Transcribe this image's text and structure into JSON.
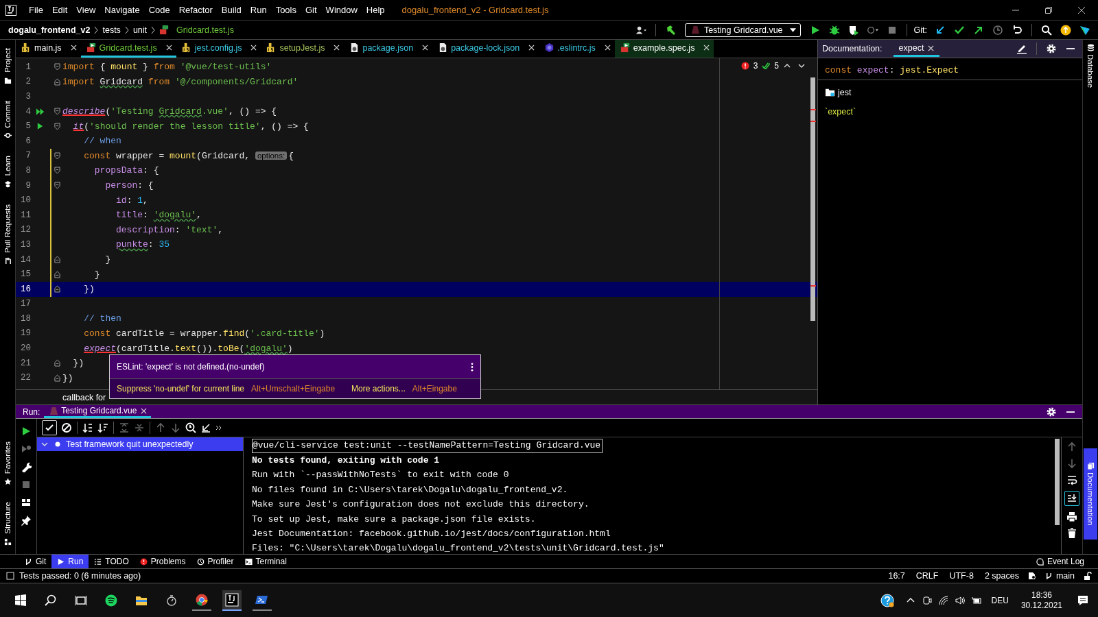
{
  "window": {
    "title": "dogalu_frontend_v2 - Gridcard.test.js"
  },
  "menu": [
    "File",
    "Edit",
    "View",
    "Navigate",
    "Code",
    "Refactor",
    "Build",
    "Run",
    "Tools",
    "Git",
    "Window",
    "Help"
  ],
  "breadcrumbs": [
    {
      "label": "dogalu_frontend_v2",
      "kind": "project"
    },
    {
      "label": "tests",
      "kind": "folder"
    },
    {
      "label": "unit",
      "kind": "folder"
    },
    {
      "label": "Gridcard.test.js",
      "kind": "file"
    }
  ],
  "toolbar": {
    "run_configuration": "Testing Gridcard.vue",
    "git_label": "Git:"
  },
  "left_strip": {
    "top": [
      {
        "label": "Project",
        "kind": "folder"
      },
      {
        "label": "Commit",
        "kind": "commit"
      },
      {
        "label": "Learn",
        "kind": "learn"
      },
      {
        "label": "Pull Requests",
        "kind": "pr"
      }
    ],
    "bottom": [
      {
        "label": "Favorites",
        "kind": "star"
      },
      {
        "label": "Structure",
        "kind": "structure"
      }
    ]
  },
  "right_strip": [
    {
      "label": "Database",
      "kind": "database",
      "selected": false
    },
    {
      "label": "Documentation",
      "kind": "doc",
      "selected": true
    }
  ],
  "tabs": [
    {
      "label": "main.js",
      "kind": "js",
      "color": "#ffffff",
      "selected": false
    },
    {
      "label": "Gridcard.test.js",
      "kind": "test",
      "color": "#6fc83b",
      "selected": true
    },
    {
      "label": "jest.config.js",
      "kind": "js",
      "color": "#3ccbe6",
      "selected": false
    },
    {
      "label": "setupJest.js",
      "kind": "js",
      "color": "#a5c25c",
      "selected": false
    },
    {
      "label": "package.json",
      "kind": "json",
      "color": "#3ccbe6",
      "selected": false
    },
    {
      "label": "package-lock.json",
      "kind": "json",
      "color": "#3ccbe6",
      "selected": false
    },
    {
      "label": ".eslintrc.js",
      "kind": "eslint",
      "color": "#3ccbe6",
      "selected": false
    },
    {
      "label": "example.spec.js",
      "kind": "test",
      "color": "#ffffff",
      "selected": false
    }
  ],
  "inspections": {
    "errors": "3",
    "warnings": "5"
  },
  "code": [
    {
      "number": "1",
      "current": false,
      "fold_start": true,
      "tokens": [
        {
          "t": "import",
          "kind": "kw"
        },
        {
          "t": " { ",
          "kind": "plain"
        },
        {
          "t": "mount",
          "kind": "fn"
        },
        {
          "t": " } ",
          "kind": "plain"
        },
        {
          "t": "from",
          "kind": "kw"
        },
        {
          "t": " '@vue/test-utils'",
          "kind": "str"
        }
      ]
    },
    {
      "number": "2",
      "current": false,
      "fold_end": true,
      "tokens": [
        {
          "t": "import ",
          "kind": "kw"
        },
        {
          "t": "Gridcard",
          "kind": "plain",
          "typo": true
        },
        {
          "t": " from",
          "kind": "kw"
        },
        {
          "t": " '@/components/Gridcard'",
          "kind": "str"
        }
      ]
    },
    {
      "number": "3",
      "current": false
    },
    {
      "number": "4",
      "current": false,
      "run_all": true,
      "fold_start": true,
      "tokens": [
        {
          "t": "describe",
          "kind": "err"
        },
        {
          "t": "(",
          "kind": "plain"
        },
        {
          "t": "'Testing ",
          "kind": "str"
        },
        {
          "t": "Gridcard",
          "kind": "str",
          "typo": true
        },
        {
          "t": ".vue'",
          "kind": "str"
        },
        {
          "t": ", () => {",
          "kind": "plain"
        }
      ]
    },
    {
      "number": "5",
      "current": false,
      "run_one": true,
      "fold_start": true,
      "tokens": [
        {
          "t": "  it",
          "kind": "err"
        },
        {
          "t": "(",
          "kind": "plain"
        },
        {
          "t": "'should render the lesson title'",
          "kind": "str"
        },
        {
          "t": ", () => {",
          "kind": "plain"
        }
      ]
    },
    {
      "number": "6",
      "current": false,
      "tokens": [
        {
          "t": "    // when",
          "kind": "cmt"
        }
      ]
    },
    {
      "number": "7",
      "current": false,
      "changed": true,
      "fold_start": true,
      "tokens": [
        {
          "t": "    const",
          "kind": "kw"
        },
        {
          "t": " wrapper = ",
          "kind": "plain"
        },
        {
          "t": "mount",
          "kind": "fn"
        },
        {
          "t": "(Gridcard, ",
          "kind": "plain"
        },
        {
          "t": "options:",
          "kind": "hint"
        },
        {
          "t": "{",
          "kind": "plain"
        }
      ]
    },
    {
      "number": "8",
      "current": false,
      "changed": true,
      "fold_start": true,
      "tokens": [
        {
          "t": "      propsData",
          "kind": "prop"
        },
        {
          "t": ": {",
          "kind": "plain"
        }
      ]
    },
    {
      "number": "9",
      "current": false,
      "changed": true,
      "fold_start": true,
      "tokens": [
        {
          "t": "        person",
          "kind": "prop"
        },
        {
          "t": ": {",
          "kind": "plain"
        }
      ]
    },
    {
      "number": "10",
      "current": false,
      "changed": true,
      "tokens": [
        {
          "t": "          id",
          "kind": "prop"
        },
        {
          "t": ": ",
          "kind": "plain"
        },
        {
          "t": "1",
          "kind": "num"
        },
        {
          "t": ",",
          "kind": "plain"
        }
      ]
    },
    {
      "number": "11",
      "current": false,
      "changed": true,
      "tokens": [
        {
          "t": "          title",
          "kind": "prop"
        },
        {
          "t": ": ",
          "kind": "plain"
        },
        {
          "t": "'dogalu'",
          "kind": "str",
          "typo": true
        },
        {
          "t": ",",
          "kind": "plain"
        }
      ]
    },
    {
      "number": "12",
      "current": false,
      "changed": true,
      "tokens": [
        {
          "t": "          description",
          "kind": "prop"
        },
        {
          "t": ": ",
          "kind": "plain"
        },
        {
          "t": "'text'",
          "kind": "str"
        },
        {
          "t": ",",
          "kind": "plain"
        }
      ]
    },
    {
      "number": "13",
      "current": false,
      "changed": true,
      "tokens": [
        {
          "t": "          punkte",
          "kind": "prop",
          "typo": true
        },
        {
          "t": ": ",
          "kind": "plain"
        },
        {
          "t": "35",
          "kind": "num"
        }
      ]
    },
    {
      "number": "14",
      "current": false,
      "changed": true,
      "fold_end": true,
      "tokens": [
        {
          "t": "        }",
          "kind": "plain"
        }
      ]
    },
    {
      "number": "15",
      "current": false,
      "changed": true,
      "fold_end": true,
      "tokens": [
        {
          "t": "      }",
          "kind": "plain"
        }
      ]
    },
    {
      "number": "16",
      "current": true,
      "changed": true,
      "fold_end": true,
      "tokens": [
        {
          "t": "    })",
          "kind": "plain"
        }
      ]
    },
    {
      "number": "17",
      "current": false
    },
    {
      "number": "18",
      "current": false,
      "tokens": [
        {
          "t": "    // then",
          "kind": "cmt"
        }
      ]
    },
    {
      "number": "19",
      "current": false,
      "tokens": [
        {
          "t": "    const",
          "kind": "kw"
        },
        {
          "t": " cardTitle = wrapper.",
          "kind": "plain"
        },
        {
          "t": "find",
          "kind": "fn"
        },
        {
          "t": "(",
          "kind": "plain"
        },
        {
          "t": "'.card-title'",
          "kind": "str"
        },
        {
          "t": ")",
          "kind": "plain"
        }
      ]
    },
    {
      "number": "20",
      "current": false,
      "tokens": [
        {
          "t": "    expect",
          "kind": "err"
        },
        {
          "t": "(cardTitle.",
          "kind": "plain"
        },
        {
          "t": "text",
          "kind": "fn"
        },
        {
          "t": "()).",
          "kind": "plain"
        },
        {
          "t": "toBe",
          "kind": "fn"
        },
        {
          "t": "(",
          "kind": "plain"
        },
        {
          "t": "'dogalu'",
          "kind": "str",
          "typo": true
        },
        {
          "t": ")",
          "kind": "plain"
        }
      ]
    },
    {
      "number": "21",
      "current": false,
      "fold_end": true,
      "tokens": [
        {
          "t": "  })",
          "kind": "plain"
        }
      ]
    },
    {
      "number": "22",
      "current": false,
      "fold_end": true,
      "tokens": [
        {
          "t": "})",
          "kind": "plain"
        }
      ]
    }
  ],
  "editor_breadcrumb": "callback for",
  "popup": {
    "message": "ESLint: 'expect' is not defined.(no-undef)",
    "actions": [
      {
        "label": "Suppress 'no-undef' for current line",
        "shortcut": "Alt+Umschalt+Eingabe"
      },
      {
        "label": "More actions...",
        "shortcut": "Alt+Eingabe"
      }
    ]
  },
  "documentation": {
    "header": "Documentation:",
    "tab": "expect",
    "signature": [
      {
        "t": "const",
        "kind": "kw"
      },
      {
        "t": " expect",
        "kind": "prop"
      },
      {
        "t": ": ",
        "kind": "plain"
      },
      {
        "t": "jest.Expect",
        "kind": "fn"
      }
    ],
    "module": "jest",
    "body": "`expect`"
  },
  "run": {
    "label": "Run:",
    "tab": "Testing Gridcard.vue",
    "tree": [
      {
        "label": "Test framework quit unexpectedly",
        "expanded": true,
        "selected": true
      }
    ],
    "console": [
      {
        "text": "@vue/cli-service test:unit --testNamePattern=Testing Gridcard.vue",
        "kind": "command"
      },
      {
        "text": "No tests found, exiting with code 1",
        "kind": "bold"
      },
      {
        "text": "Run with `--passWithNoTests` to exit with code 0",
        "kind": "text"
      },
      {
        "text": "No files found in C:\\Users\\tarek\\Dogalu\\dogalu_frontend_v2.",
        "kind": "text"
      },
      {
        "text": "Make sure Jest's configuration does not exclude this directory.",
        "kind": "text"
      },
      {
        "text": "To set up Jest, make sure a package.json file exists.",
        "kind": "text"
      },
      {
        "text": "Jest Documentation: facebook.github.io/jest/docs/configuration.html",
        "kind": "text"
      },
      {
        "text": "Files: \"C:\\Users\\tarek\\Dogalu\\dogalu_frontend_v2\\tests\\unit\\Gridcard.test.js\"",
        "kind": "text"
      }
    ]
  },
  "tool_windows": [
    {
      "label": "Git",
      "kind": "git",
      "selected": false
    },
    {
      "label": "Run",
      "kind": "run",
      "selected": true
    },
    {
      "label": "TODO",
      "kind": "todo",
      "selected": false
    },
    {
      "label": "Problems",
      "kind": "problems",
      "selected": false
    },
    {
      "label": "Profiler",
      "kind": "profiler",
      "selected": false
    },
    {
      "label": "Terminal",
      "kind": "terminal",
      "selected": false
    }
  ],
  "event_log": "Event Log",
  "status_bar": {
    "message": "Tests passed: 0 (6 minutes ago)",
    "position": "16:7",
    "line_separator": "CRLF",
    "encoding": "UTF-8",
    "indent": "2 spaces",
    "branch": "main"
  },
  "taskbar": {
    "language": "DEU",
    "time": "18:36",
    "date": "30.12.2021"
  }
}
